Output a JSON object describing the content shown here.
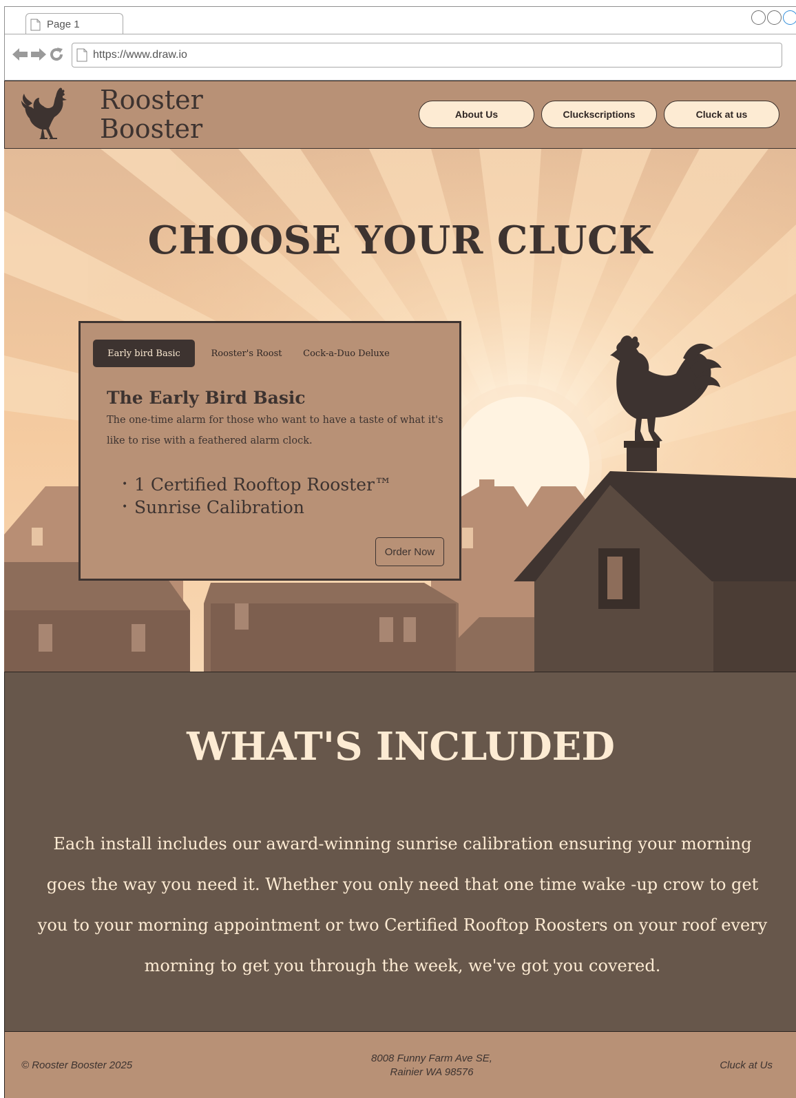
{
  "browser": {
    "tab_label": "Page 1",
    "url": "https://www.draw.io"
  },
  "header": {
    "brand_line1": "Rooster",
    "brand_line2": "Booster",
    "nav": [
      "About Us",
      "Cluckscriptions",
      "Cluck at us"
    ]
  },
  "hero": {
    "title": "CHOOSE YOUR CLUCK",
    "plan_tabs": [
      "Early bird Basic",
      "Rooster's Roost",
      "Cock-a-Duo Deluxe"
    ],
    "active_tab": "Early bird Basic",
    "plan_title": "The Early Bird Basic",
    "plan_description": "The one-time alarm for those who want to have a taste of what it's like to rise with a feathered alarm clock.",
    "features": [
      "1 Certified Rooftop Rooster™",
      "Sunrise Calibration"
    ],
    "order_button": "Order Now"
  },
  "included": {
    "title": "WHAT'S INCLUDED",
    "body": "Each install includes our award-winning sunrise calibration ensuring your morning goes the way you need it. Whether you only need that one time wake -up crow to get you to your morning appointment or two Certified Rooftop Roosters on your roof every morning to get you through the week, we've got you covered."
  },
  "footer": {
    "copyright": "© Rooster Booster 2025",
    "address_line1": "8008 Funny Farm Ave SE,",
    "address_line2": "Rainier WA 98576",
    "contact_link": "Cluck at Us"
  },
  "colors": {
    "brown_light": "#b89176",
    "brown_dark": "#67574b",
    "cream": "#fdebd3",
    "ink": "#3d3330"
  }
}
